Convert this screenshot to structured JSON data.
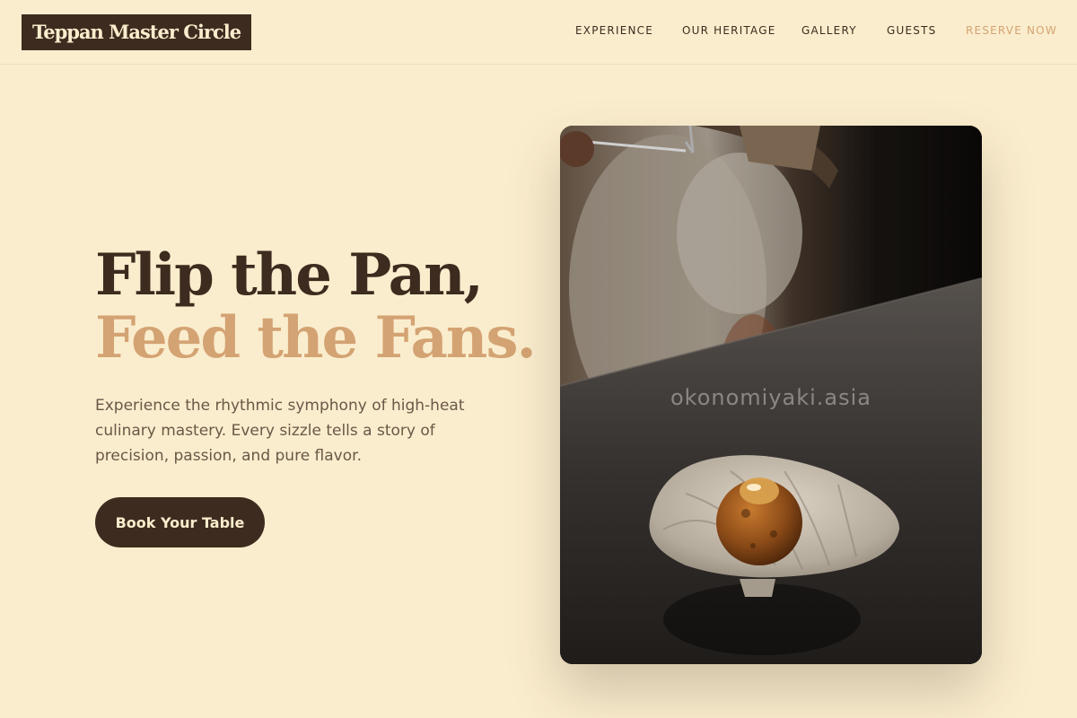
{
  "header": {
    "logo": "Teppan Master Circle",
    "nav": [
      "EXPERIENCE",
      "OUR HERITAGE",
      "GALLERY",
      "GUESTS"
    ],
    "reserve": "RESERVE NOW"
  },
  "hero": {
    "title_line1": "Flip the Pan,",
    "title_line2": "Feed the Fans.",
    "description": "Experience the rhythmic symphony of high-heat culinary mastery. Every sizzle tells a story of precision, passion, and pure flavor.",
    "cta": "Book Your Table"
  },
  "photo": {
    "watermark": "okonomiyaki.asia"
  },
  "colors": {
    "background": "#faedcd",
    "brown": "#3d2b1f",
    "accent": "#d4a373"
  }
}
